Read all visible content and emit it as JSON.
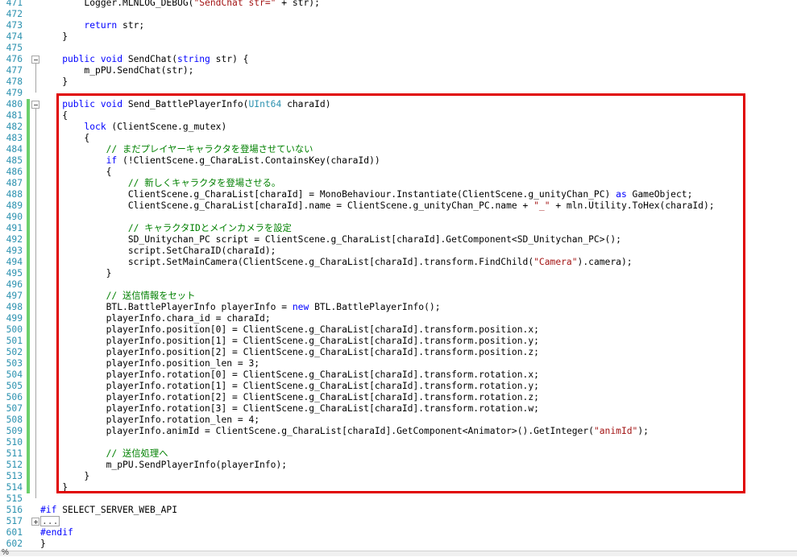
{
  "status": {
    "zoom": "%"
  },
  "selection_highlight_color": "#e00000",
  "changed_line_color": "#6ccf6c",
  "lines": [
    {
      "n": "471",
      "fold": "",
      "bar": false,
      "tokens": [
        [
          "",
          "        Logger.MLNLOG_DEBUG("
        ],
        [
          "st",
          "\"SendChat str=\""
        ],
        [
          "",
          " + str);"
        ]
      ]
    },
    {
      "n": "472",
      "fold": "",
      "bar": false,
      "tokens": []
    },
    {
      "n": "473",
      "fold": "",
      "bar": false,
      "tokens": [
        [
          "kw",
          "        return"
        ],
        [
          "",
          " str;"
        ]
      ]
    },
    {
      "n": "474",
      "fold": "",
      "bar": false,
      "tokens": [
        [
          "",
          "    }"
        ]
      ]
    },
    {
      "n": "475",
      "fold": "",
      "bar": false,
      "tokens": []
    },
    {
      "n": "476",
      "fold": "minus",
      "bar": false,
      "tokens": [
        [
          "kw",
          "    public void"
        ],
        [
          "",
          " SendChat("
        ],
        [
          "kw",
          "string"
        ],
        [
          "",
          " str) {"
        ]
      ]
    },
    {
      "n": "477",
      "fold": "",
      "bar": false,
      "tokens": [
        [
          "",
          "        m_pPU.SendChat(str);"
        ]
      ]
    },
    {
      "n": "478",
      "fold": "",
      "bar": false,
      "tokens": [
        [
          "",
          "    }"
        ]
      ]
    },
    {
      "n": "479",
      "fold": "",
      "bar": false,
      "tokens": []
    },
    {
      "n": "480",
      "fold": "minus",
      "bar": true,
      "tokens": [
        [
          "kw",
          "    public void"
        ],
        [
          "",
          " Send_BattlePlayerInfo("
        ],
        [
          "ty",
          "UInt64"
        ],
        [
          "",
          " charaId)"
        ]
      ]
    },
    {
      "n": "481",
      "fold": "",
      "bar": true,
      "tokens": [
        [
          "",
          "    {"
        ]
      ]
    },
    {
      "n": "482",
      "fold": "",
      "bar": true,
      "tokens": [
        [
          "kw",
          "        lock"
        ],
        [
          "",
          " (ClientScene.g_mutex)"
        ]
      ]
    },
    {
      "n": "483",
      "fold": "",
      "bar": true,
      "tokens": [
        [
          "",
          "        {"
        ]
      ]
    },
    {
      "n": "484",
      "fold": "",
      "bar": true,
      "tokens": [
        [
          "cm",
          "            // まだプレイヤーキャラクタを登場させていない"
        ]
      ]
    },
    {
      "n": "485",
      "fold": "",
      "bar": true,
      "tokens": [
        [
          "kw",
          "            if"
        ],
        [
          "",
          " (!ClientScene.g_CharaList.ContainsKey(charaId))"
        ]
      ]
    },
    {
      "n": "486",
      "fold": "",
      "bar": true,
      "tokens": [
        [
          "",
          "            {"
        ]
      ]
    },
    {
      "n": "487",
      "fold": "",
      "bar": true,
      "tokens": [
        [
          "cm",
          "                // 新しくキャラクタを登場させる。"
        ]
      ]
    },
    {
      "n": "488",
      "fold": "",
      "bar": true,
      "tokens": [
        [
          "",
          "                ClientScene.g_CharaList[charaId] = MonoBehaviour.Instantiate(ClientScene.g_unityChan_PC) "
        ],
        [
          "kw",
          "as"
        ],
        [
          "",
          " GameObject;"
        ]
      ]
    },
    {
      "n": "489",
      "fold": "",
      "bar": true,
      "tokens": [
        [
          "",
          "                ClientScene.g_CharaList[charaId].name = ClientScene.g_unityChan_PC.name + "
        ],
        [
          "st",
          "\"_\""
        ],
        [
          "",
          " + mln.Utility.ToHex(charaId);"
        ]
      ]
    },
    {
      "n": "490",
      "fold": "",
      "bar": true,
      "tokens": []
    },
    {
      "n": "491",
      "fold": "",
      "bar": true,
      "tokens": [
        [
          "cm",
          "                // キャラクタIDとメインカメラを設定"
        ]
      ]
    },
    {
      "n": "492",
      "fold": "",
      "bar": true,
      "tokens": [
        [
          "",
          "                SD_Unitychan_PC script = ClientScene.g_CharaList[charaId].GetComponent<SD_Unitychan_PC>();"
        ]
      ]
    },
    {
      "n": "493",
      "fold": "",
      "bar": true,
      "tokens": [
        [
          "",
          "                script.SetCharaID(charaId);"
        ]
      ]
    },
    {
      "n": "494",
      "fold": "",
      "bar": true,
      "tokens": [
        [
          "",
          "                script.SetMainCamera(ClientScene.g_CharaList[charaId].transform.FindChild("
        ],
        [
          "st",
          "\"Camera\""
        ],
        [
          "",
          ").camera);"
        ]
      ]
    },
    {
      "n": "495",
      "fold": "",
      "bar": true,
      "tokens": [
        [
          "",
          "            }"
        ]
      ]
    },
    {
      "n": "496",
      "fold": "",
      "bar": true,
      "tokens": []
    },
    {
      "n": "497",
      "fold": "",
      "bar": true,
      "tokens": [
        [
          "cm",
          "            // 送信情報をセット"
        ]
      ]
    },
    {
      "n": "498",
      "fold": "",
      "bar": true,
      "tokens": [
        [
          "",
          "            BTL.BattlePlayerInfo playerInfo = "
        ],
        [
          "kw",
          "new"
        ],
        [
          "",
          " BTL.BattlePlayerInfo();"
        ]
      ]
    },
    {
      "n": "499",
      "fold": "",
      "bar": true,
      "tokens": [
        [
          "",
          "            playerInfo.chara_id = charaId;"
        ]
      ]
    },
    {
      "n": "500",
      "fold": "",
      "bar": true,
      "tokens": [
        [
          "",
          "            playerInfo.position[0] = ClientScene.g_CharaList[charaId].transform.position.x;"
        ]
      ]
    },
    {
      "n": "501",
      "fold": "",
      "bar": true,
      "tokens": [
        [
          "",
          "            playerInfo.position[1] = ClientScene.g_CharaList[charaId].transform.position.y;"
        ]
      ]
    },
    {
      "n": "502",
      "fold": "",
      "bar": true,
      "tokens": [
        [
          "",
          "            playerInfo.position[2] = ClientScene.g_CharaList[charaId].transform.position.z;"
        ]
      ]
    },
    {
      "n": "503",
      "fold": "",
      "bar": true,
      "tokens": [
        [
          "",
          "            playerInfo.position_len = 3;"
        ]
      ]
    },
    {
      "n": "504",
      "fold": "",
      "bar": true,
      "tokens": [
        [
          "",
          "            playerInfo.rotation[0] = ClientScene.g_CharaList[charaId].transform.rotation.x;"
        ]
      ]
    },
    {
      "n": "505",
      "fold": "",
      "bar": true,
      "tokens": [
        [
          "",
          "            playerInfo.rotation[1] = ClientScene.g_CharaList[charaId].transform.rotation.y;"
        ]
      ]
    },
    {
      "n": "506",
      "fold": "",
      "bar": true,
      "tokens": [
        [
          "",
          "            playerInfo.rotation[2] = ClientScene.g_CharaList[charaId].transform.rotation.z;"
        ]
      ]
    },
    {
      "n": "507",
      "fold": "",
      "bar": true,
      "tokens": [
        [
          "",
          "            playerInfo.rotation[3] = ClientScene.g_CharaList[charaId].transform.rotation.w;"
        ]
      ]
    },
    {
      "n": "508",
      "fold": "",
      "bar": true,
      "tokens": [
        [
          "",
          "            playerInfo.rotation_len = 4;"
        ]
      ]
    },
    {
      "n": "509",
      "fold": "",
      "bar": true,
      "tokens": [
        [
          "",
          "            playerInfo.animId = ClientScene.g_CharaList[charaId].GetComponent<Animator>().GetInteger("
        ],
        [
          "st",
          "\"animId\""
        ],
        [
          "",
          ");"
        ]
      ]
    },
    {
      "n": "510",
      "fold": "",
      "bar": true,
      "tokens": []
    },
    {
      "n": "511",
      "fold": "",
      "bar": true,
      "tokens": [
        [
          "cm",
          "            // 送信処理へ"
        ]
      ]
    },
    {
      "n": "512",
      "fold": "",
      "bar": true,
      "tokens": [
        [
          "",
          "            m_pPU.SendPlayerInfo(playerInfo);"
        ]
      ]
    },
    {
      "n": "513",
      "fold": "",
      "bar": true,
      "tokens": [
        [
          "",
          "        }"
        ]
      ]
    },
    {
      "n": "514",
      "fold": "",
      "bar": true,
      "tokens": [
        [
          "",
          "    }"
        ]
      ]
    },
    {
      "n": "515",
      "fold": "",
      "bar": false,
      "tokens": []
    },
    {
      "n": "516",
      "fold": "",
      "bar": false,
      "tokens": [
        [
          "pp",
          "#if"
        ],
        [
          "",
          " SELECT_SERVER_WEB_API"
        ]
      ]
    },
    {
      "n": "517",
      "fold": "plus",
      "bar": false,
      "tokens": [
        [
          "box",
          "..."
        ]
      ]
    },
    {
      "n": "601",
      "fold": "",
      "bar": false,
      "tokens": [
        [
          "pp",
          "#endif"
        ]
      ]
    },
    {
      "n": "602",
      "fold": "",
      "bar": false,
      "tokens": [
        [
          "",
          "}"
        ]
      ]
    }
  ]
}
